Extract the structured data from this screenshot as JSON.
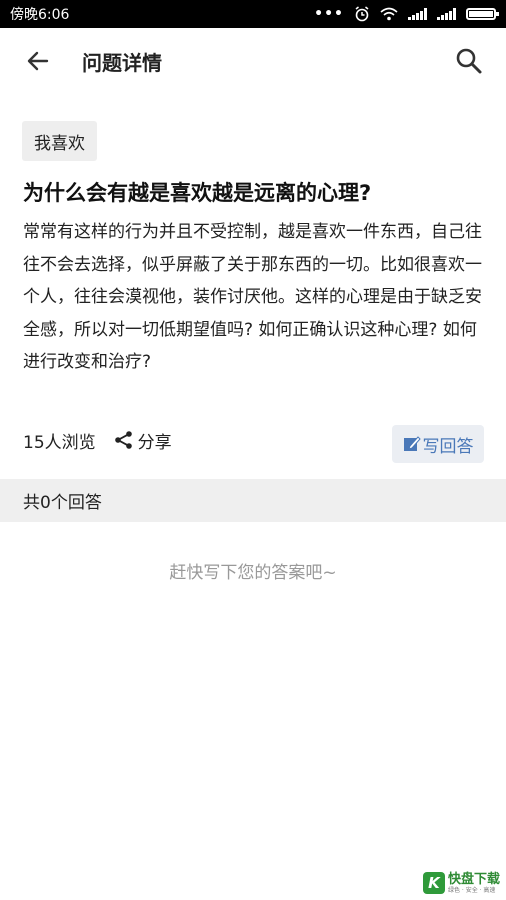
{
  "status_bar": {
    "time": "傍晚6:06",
    "icons": [
      "more-dots-icon",
      "alarm-icon",
      "wifi-icon",
      "signal-icon",
      "signal-icon",
      "battery-icon"
    ]
  },
  "app_bar": {
    "title": "问题详情",
    "back_icon": "arrow-left-icon",
    "search_icon": "search-icon"
  },
  "question": {
    "tag": "我喜欢",
    "title": "为什么会有越是喜欢越是远离的心理?",
    "body": "常常有这样的行为并且不受控制，越是喜欢一件东西，自己往往不会去选择，似乎屏蔽了关于那东西的一切。比如很喜欢一个人，往往会漠视他，装作讨厌他。这样的心理是由于缺乏安全感，所以对一切低期望值吗? 如何正确认识这种心理? 如何进行改变和治疗?",
    "views": "15人浏览",
    "share_label": "分享",
    "write_answer_label": "写回答"
  },
  "answers": {
    "count_label": "共0个回答",
    "empty_hint": "赶快写下您的答案吧~"
  },
  "watermark": {
    "logo_letter": "K",
    "text": "快盘下载",
    "sub": "绿色 · 安全 · 高速"
  },
  "colors": {
    "accent": "#4a78b8",
    "section_bg": "#efefef",
    "tag_bg": "#eeeeee",
    "hint": "#999999"
  }
}
